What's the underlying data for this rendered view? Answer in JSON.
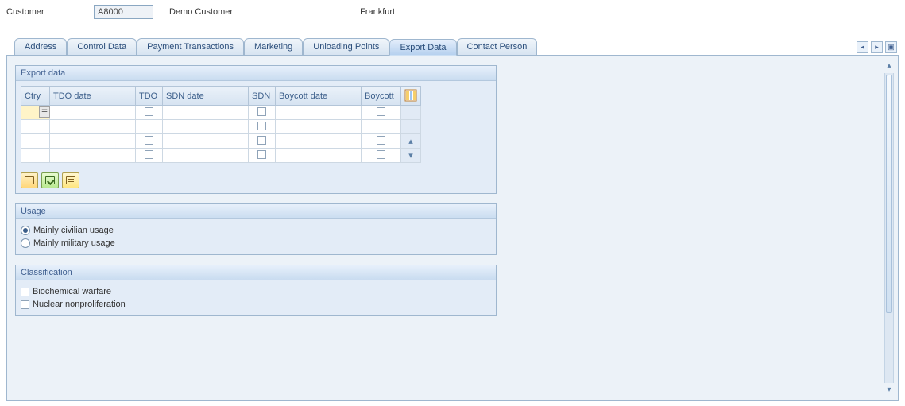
{
  "header": {
    "customer_label": "Customer",
    "customer_value": "A8000",
    "customer_name": "Demo Customer",
    "city": "Frankfurt"
  },
  "tabs": [
    {
      "label": "Address"
    },
    {
      "label": "Control Data"
    },
    {
      "label": "Payment Transactions"
    },
    {
      "label": "Marketing"
    },
    {
      "label": "Unloading Points"
    },
    {
      "label": "Export Data"
    },
    {
      "label": "Contact Person"
    }
  ],
  "active_tab": "Export Data",
  "groups": {
    "export": {
      "title": "Export data",
      "columns": {
        "ctry": "Ctry",
        "tdo_date": "TDO date",
        "tdo": "TDO",
        "sdn_date": "SDN date",
        "sdn": "SDN",
        "boycott_date": "Boycott date",
        "boycott": "Boycott"
      }
    },
    "usage": {
      "title": "Usage",
      "options": {
        "civilian": "Mainly civilian usage",
        "military": "Mainly military usage"
      },
      "selected": "civilian"
    },
    "classification": {
      "title": "Classification",
      "options": {
        "bio": "Biochemical warfare",
        "nuclear": "Nuclear nonproliferation"
      }
    }
  },
  "icons": {
    "tab_first": "◂",
    "tab_last": "▸",
    "tab_list": "▣"
  }
}
